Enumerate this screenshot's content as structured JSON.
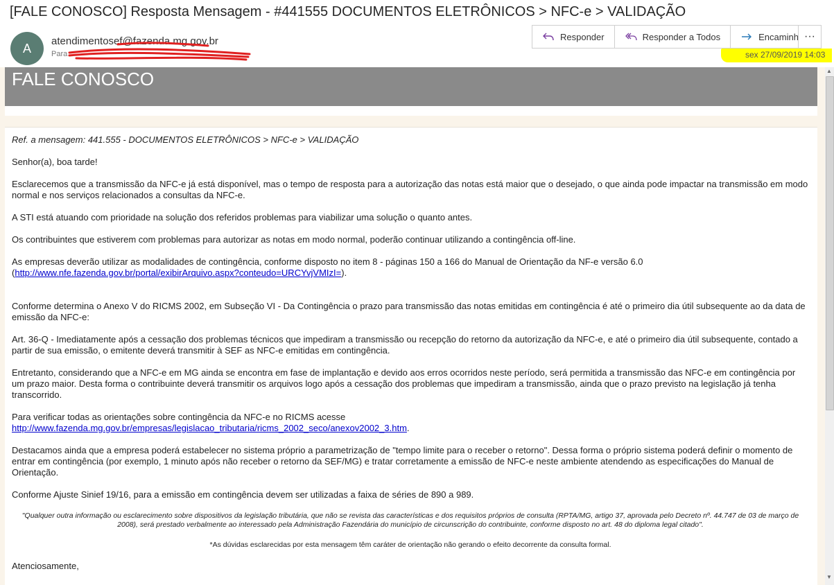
{
  "header": {
    "subject": "[FALE CONOSCO] Resposta Mensagem - #441555  DOCUMENTOS ELETRÔNICOS > NFC-e > VALIDAÇÃO",
    "avatar_letter": "A",
    "sender": "atendimentosef@fazenda.mg.gov.br",
    "to_label": "Para",
    "date": "sex 27/09/2019 14:03"
  },
  "actions": {
    "reply": "Responder",
    "reply_all": "Responder a Todos",
    "forward": "Encaminhar",
    "more": "···"
  },
  "banner": {
    "title": "FALE CONOSCO"
  },
  "message": {
    "ref": "Ref. a mensagem: 441.555 - DOCUMENTOS ELETRÔNICOS > NFC-e > VALIDAÇÃO",
    "greeting": "Senhor(a), boa tarde!",
    "p1": "Esclarecemos que a transmissão da NFC-e já está disponível, mas o tempo de resposta para a autorização das notas está maior que o desejado, o que ainda pode impactar na transmissão em modo normal e nos serviços relacionados a consultas da NFC-e.",
    "p2": "A STI está atuando com prioridade na solução dos referidos problemas para viabilizar uma solução o quanto antes.",
    "p3": "Os contribuintes que estiverem com problemas para autorizar as notas em modo normal, poderão continuar utilizando a contingência off-line.",
    "p4": "As empresas deverão utilizar as modalidades de contingência, conforme disposto no item 8 - páginas 150 a 166 do Manual de Orientação da NF-e versão 6.0",
    "p4_link": "http://www.nfe.fazenda.gov.br/portal/exibirArquivo.aspx?conteudo=URCYvjVMIzI=",
    "p5": "Conforme determina o Anexo V do RICMS 2002, em Subseção VI - Da Contingência o prazo para transmissão das notas emitidas em contingência é até o primeiro dia útil subsequente ao da data de emissão da NFC-e:",
    "p6": "Art. 36-Q - Imediatamente após a cessação dos problemas técnicos que impediram a transmissão ou recepção do retorno da autorização da NFC-e, e até o primeiro dia útil subsequente, contado a partir de sua emissão, o emitente deverá transmitir à SEF as NFC-e emitidas em contingência.",
    "p7": "Entretanto, considerando que a NFC-e em MG ainda se encontra em fase de implantação e devido aos erros ocorridos neste período, será permitida a transmissão das NFC-e em contingência por um prazo maior. Desta forma o contribuinte deverá transmitir os arquivos logo após a cessação dos problemas que impediram a transmissão, ainda que o prazo previsto na legislação já tenha transcorrido.",
    "p8": "Para verificar todas as orientações sobre contingência da NFC-e no RICMS acesse",
    "p8_link": "http://www.fazenda.mg.gov.br/empresas/legislacao_tributaria/ricms_2002_seco/anexov2002_3.htm",
    "p9": "Destacamos ainda que a empresa poderá estabelecer no sistema próprio a parametrização de \"tempo limite para o receber o retorno\". Dessa forma o próprio sistema poderá definir o momento de entrar em contingência (por exemplo, 1 minuto após não receber o retorno da SEF/MG) e tratar corretamente a emissão de NFC-e neste ambiente atendendo as especificações do Manual de Orientação.",
    "p10": "Conforme Ajuste Sinief 19/16, para a emissão em contingência devem ser utilizadas a faixa de séries de 890 a 989.",
    "disclaimer": "\"Qualquer outra informação ou esclarecimento sobre dispositivos da legislação tributária, que não se revista das características e dos requisitos próprios de consulta (RPTA/MG, artigo 37, aprovada pelo Decreto nº. 44.747 de 03 de março de 2008), será prestado verbalmente ao interessado pela Administração Fazendária do município de circunscrição do contribuinte, conforme disposto no art. 48 do diploma legal citado\".",
    "disclaimer2": "*As dúvidas esclarecidas por esta mensagem têm caráter de orientação não gerando o efeito decorrente da consulta formal.",
    "closing": "Atenciosamente,"
  },
  "colors": {
    "banner": "#8a8a8a",
    "highlight": "#ffff00",
    "link": "#0000cc",
    "redaction": "#e02020"
  }
}
